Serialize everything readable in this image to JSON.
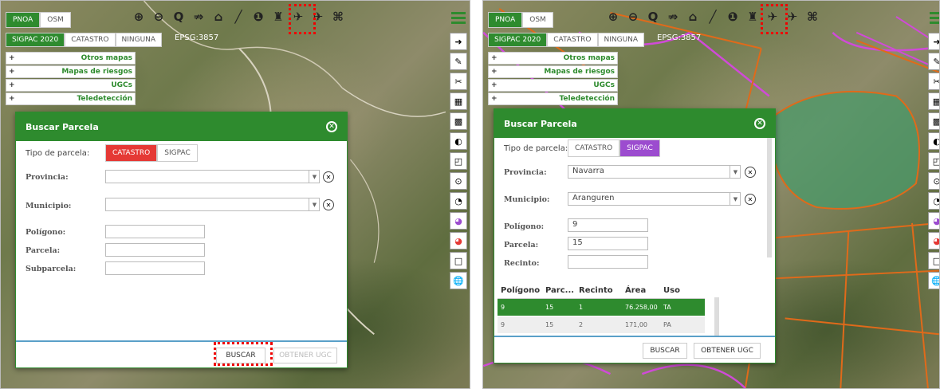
{
  "left": {
    "basemap": [
      "PNOA",
      "OSM"
    ],
    "layers": [
      "SIGPAC 2020",
      "CATASTRO",
      "NINGUNA"
    ],
    "epsg": "EPSG:3857",
    "accordion": [
      "Otros mapas",
      "Mapas de riesgos",
      "UGCs",
      "Teledetección"
    ],
    "dialog": {
      "title": "Buscar Parcela",
      "tipo_label": "Tipo de parcela:",
      "tipo_options": [
        "CATASTRO",
        "SIGPAC"
      ],
      "tipo_selected": "CATASTRO",
      "provincia_label": "Provincia:",
      "provincia_value": "",
      "municipio_label": "Municipio:",
      "municipio_value": "",
      "poligono_label": "Polígono:",
      "poligono_value": "",
      "parcela_label": "Parcela:",
      "parcela_value": "",
      "subparcela_label": "Subparcela:",
      "subparcela_value": "",
      "buscar": "BUSCAR",
      "obtener": "OBTENER UGC"
    }
  },
  "right": {
    "basemap": [
      "PNOA",
      "OSM"
    ],
    "layers": [
      "SIGPAC 2020",
      "CATASTRO",
      "NINGUNA"
    ],
    "epsg": "EPSG:3857",
    "accordion": [
      "Otros mapas",
      "Mapas de riesgos",
      "UGCs",
      "Teledetección"
    ],
    "dialog": {
      "title": "Buscar Parcela",
      "tipo_label": "Tipo de parcela:",
      "tipo_options": [
        "CATASTRO",
        "SIGPAC"
      ],
      "tipo_selected": "SIGPAC",
      "provincia_label": "Provincia:",
      "provincia_value": "Navarra",
      "municipio_label": "Municipio:",
      "municipio_value": "Aranguren",
      "poligono_label": "Polígono:",
      "poligono_value": "9",
      "parcela_label": "Parcela:",
      "parcela_value": "15",
      "recinto_label": "Recinto:",
      "recinto_value": "",
      "table": {
        "headers": [
          "Polígono",
          "Parc...",
          "Recinto",
          "Área",
          "Uso"
        ],
        "rows": [
          [
            "9",
            "15",
            "1",
            "76.258,00",
            "TA"
          ],
          [
            "9",
            "15",
            "2",
            "171,00",
            "PA"
          ]
        ]
      },
      "buscar": "BUSCAR",
      "obtener": "OBTENER UGC"
    }
  },
  "toolbar_icons": [
    "zoom-in-icon",
    "zoom-out-icon",
    "zoom-extent-icon",
    "filter-icon",
    "polygon-icon",
    "ruler-icon",
    "info-icon",
    "binoculars-icon",
    "satellite-icon",
    "satellite-info-icon",
    "drone-icon"
  ],
  "colors": {
    "primary": "#2e8b2e",
    "catastro": "#e53935",
    "sigpac": "#9c4ccf",
    "highlight": "#e00000",
    "parcel_lines": "#e06a1a",
    "sigpac_lines": "#d04ad8"
  }
}
